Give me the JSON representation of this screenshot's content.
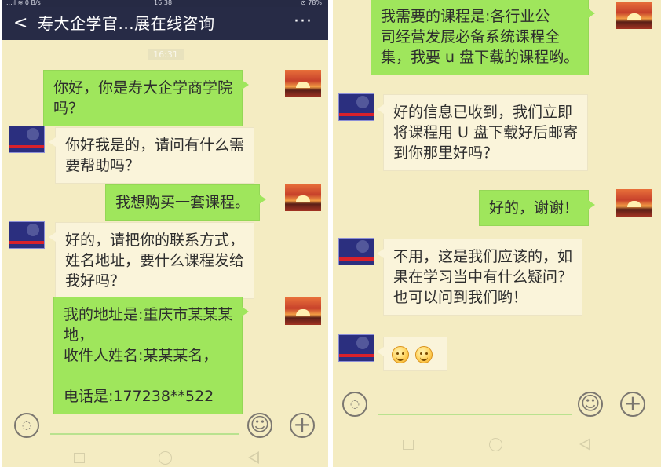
{
  "left": {
    "status_bar": {
      "left": "...ıl ≋ 0 B/s",
      "time": "16:38",
      "right": "⊙ 78%"
    },
    "title_bar": {
      "back": "<",
      "title": "寿大企学官...展在线咨询",
      "more": "···"
    },
    "time_chip": "16:31",
    "messages": [
      {
        "sender": "me",
        "lines": [
          "你好，你是寿大企学商学院",
          "吗？"
        ]
      },
      {
        "sender": "other",
        "lines": [
          "你好我是的，请问有什么需",
          "要帮助吗？"
        ]
      },
      {
        "sender": "me",
        "lines": [
          "我想购买一套课程。"
        ]
      },
      {
        "sender": "other",
        "lines": [
          "好的，请把你的联系方式，",
          "姓名地址，要什么课程发给",
          "我好吗？"
        ]
      },
      {
        "sender": "me",
        "lines": [
          "我的地址是:重庆市某某某",
          "地，",
          "收件人姓名:某某某名，",
          "",
          "电话是:177238**522"
        ]
      }
    ]
  },
  "right": {
    "messages": [
      {
        "sender": "me",
        "lines": [
          "我需要的课程是:各行业公",
          "司经营发展必备系统课程全",
          "集，我要 u 盘下载的课程哟。"
        ]
      },
      {
        "sender": "other",
        "lines": [
          "好的信息已收到，我们立即",
          "将课程用 U 盘下载好后邮寄",
          "到你那里好吗？"
        ]
      },
      {
        "sender": "me",
        "lines": [
          "好的，谢谢！"
        ]
      },
      {
        "sender": "other",
        "lines": [
          "不用，这是我们应该的，如",
          "果在学习当中有什么疑问？",
          "也可以问到我们哟！"
        ]
      },
      {
        "sender": "other",
        "emoji": [
          "smile",
          "smile"
        ]
      }
    ]
  },
  "icons": {
    "voice": "voice-icon",
    "emoji": "emoji-icon",
    "plus": "plus-icon",
    "nav": [
      "square-nav-icon",
      "circle-nav-icon",
      "triangle-back-icon"
    ]
  },
  "colors": {
    "chat_background": "#f4ecc2",
    "header": "#272b46",
    "sent_bubble": "#9fe65c",
    "received_bubble": "#faf4da"
  }
}
